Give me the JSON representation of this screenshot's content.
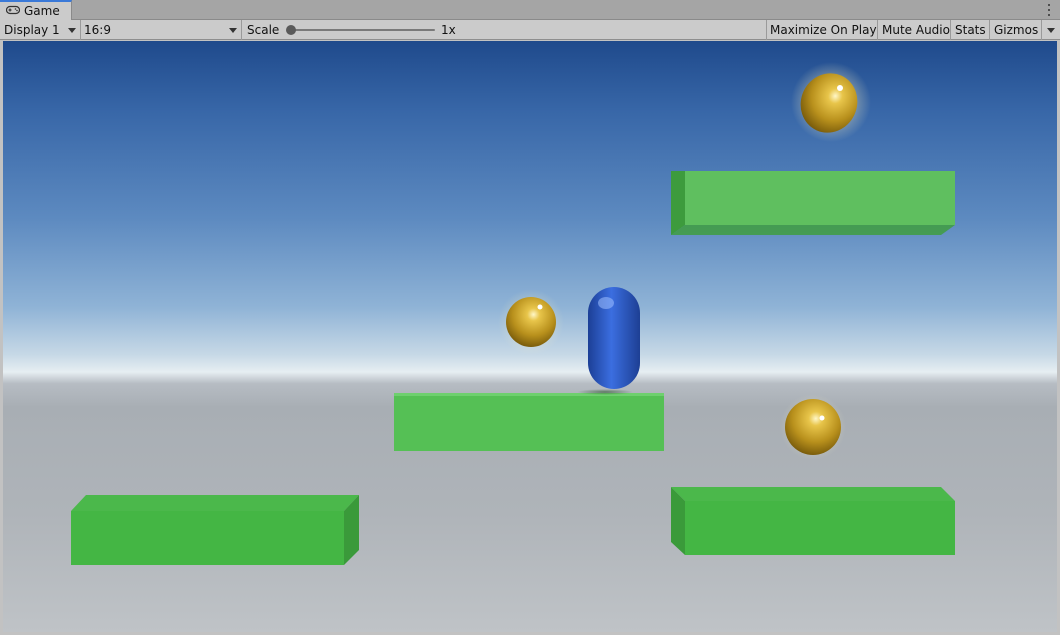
{
  "tab": {
    "title": "Game",
    "icon": "gamepad-icon"
  },
  "toolbar": {
    "display": "Display 1",
    "aspect": "16:9",
    "scale_label": "Scale",
    "scale_value": "1x",
    "scale_level": 0,
    "maximize_on_play": "Maximize On Play",
    "mute_audio": "Mute Audio",
    "stats": "Stats",
    "gizmos": "Gizmos"
  },
  "scene": {
    "colors": {
      "platform": "#4fbf4f",
      "player": "#2f62d0",
      "coin": "#c9a226"
    }
  }
}
